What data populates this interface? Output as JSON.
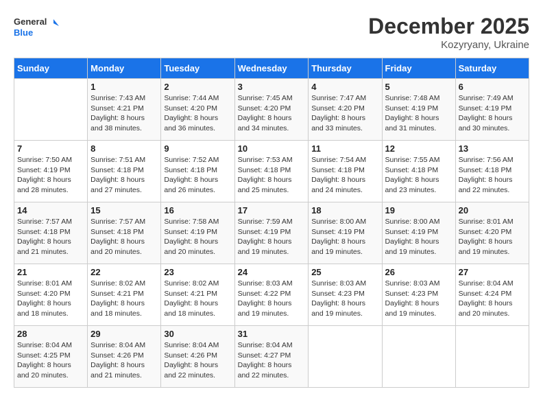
{
  "header": {
    "logo_general": "General",
    "logo_blue": "Blue",
    "month_title": "December 2025",
    "subtitle": "Kozyryany, Ukraine"
  },
  "days_of_week": [
    "Sunday",
    "Monday",
    "Tuesday",
    "Wednesday",
    "Thursday",
    "Friday",
    "Saturday"
  ],
  "weeks": [
    [
      {
        "day": "",
        "sunrise": "",
        "sunset": "",
        "daylight": ""
      },
      {
        "day": "1",
        "sunrise": "Sunrise: 7:43 AM",
        "sunset": "Sunset: 4:21 PM",
        "daylight": "Daylight: 8 hours and 38 minutes."
      },
      {
        "day": "2",
        "sunrise": "Sunrise: 7:44 AM",
        "sunset": "Sunset: 4:20 PM",
        "daylight": "Daylight: 8 hours and 36 minutes."
      },
      {
        "day": "3",
        "sunrise": "Sunrise: 7:45 AM",
        "sunset": "Sunset: 4:20 PM",
        "daylight": "Daylight: 8 hours and 34 minutes."
      },
      {
        "day": "4",
        "sunrise": "Sunrise: 7:47 AM",
        "sunset": "Sunset: 4:20 PM",
        "daylight": "Daylight: 8 hours and 33 minutes."
      },
      {
        "day": "5",
        "sunrise": "Sunrise: 7:48 AM",
        "sunset": "Sunset: 4:19 PM",
        "daylight": "Daylight: 8 hours and 31 minutes."
      },
      {
        "day": "6",
        "sunrise": "Sunrise: 7:49 AM",
        "sunset": "Sunset: 4:19 PM",
        "daylight": "Daylight: 8 hours and 30 minutes."
      }
    ],
    [
      {
        "day": "7",
        "sunrise": "Sunrise: 7:50 AM",
        "sunset": "Sunset: 4:19 PM",
        "daylight": "Daylight: 8 hours and 28 minutes."
      },
      {
        "day": "8",
        "sunrise": "Sunrise: 7:51 AM",
        "sunset": "Sunset: 4:18 PM",
        "daylight": "Daylight: 8 hours and 27 minutes."
      },
      {
        "day": "9",
        "sunrise": "Sunrise: 7:52 AM",
        "sunset": "Sunset: 4:18 PM",
        "daylight": "Daylight: 8 hours and 26 minutes."
      },
      {
        "day": "10",
        "sunrise": "Sunrise: 7:53 AM",
        "sunset": "Sunset: 4:18 PM",
        "daylight": "Daylight: 8 hours and 25 minutes."
      },
      {
        "day": "11",
        "sunrise": "Sunrise: 7:54 AM",
        "sunset": "Sunset: 4:18 PM",
        "daylight": "Daylight: 8 hours and 24 minutes."
      },
      {
        "day": "12",
        "sunrise": "Sunrise: 7:55 AM",
        "sunset": "Sunset: 4:18 PM",
        "daylight": "Daylight: 8 hours and 23 minutes."
      },
      {
        "day": "13",
        "sunrise": "Sunrise: 7:56 AM",
        "sunset": "Sunset: 4:18 PM",
        "daylight": "Daylight: 8 hours and 22 minutes."
      }
    ],
    [
      {
        "day": "14",
        "sunrise": "Sunrise: 7:57 AM",
        "sunset": "Sunset: 4:18 PM",
        "daylight": "Daylight: 8 hours and 21 minutes."
      },
      {
        "day": "15",
        "sunrise": "Sunrise: 7:57 AM",
        "sunset": "Sunset: 4:18 PM",
        "daylight": "Daylight: 8 hours and 20 minutes."
      },
      {
        "day": "16",
        "sunrise": "Sunrise: 7:58 AM",
        "sunset": "Sunset: 4:19 PM",
        "daylight": "Daylight: 8 hours and 20 minutes."
      },
      {
        "day": "17",
        "sunrise": "Sunrise: 7:59 AM",
        "sunset": "Sunset: 4:19 PM",
        "daylight": "Daylight: 8 hours and 19 minutes."
      },
      {
        "day": "18",
        "sunrise": "Sunrise: 8:00 AM",
        "sunset": "Sunset: 4:19 PM",
        "daylight": "Daylight: 8 hours and 19 minutes."
      },
      {
        "day": "19",
        "sunrise": "Sunrise: 8:00 AM",
        "sunset": "Sunset: 4:19 PM",
        "daylight": "Daylight: 8 hours and 19 minutes."
      },
      {
        "day": "20",
        "sunrise": "Sunrise: 8:01 AM",
        "sunset": "Sunset: 4:20 PM",
        "daylight": "Daylight: 8 hours and 19 minutes."
      }
    ],
    [
      {
        "day": "21",
        "sunrise": "Sunrise: 8:01 AM",
        "sunset": "Sunset: 4:20 PM",
        "daylight": "Daylight: 8 hours and 18 minutes."
      },
      {
        "day": "22",
        "sunrise": "Sunrise: 8:02 AM",
        "sunset": "Sunset: 4:21 PM",
        "daylight": "Daylight: 8 hours and 18 minutes."
      },
      {
        "day": "23",
        "sunrise": "Sunrise: 8:02 AM",
        "sunset": "Sunset: 4:21 PM",
        "daylight": "Daylight: 8 hours and 18 minutes."
      },
      {
        "day": "24",
        "sunrise": "Sunrise: 8:03 AM",
        "sunset": "Sunset: 4:22 PM",
        "daylight": "Daylight: 8 hours and 19 minutes."
      },
      {
        "day": "25",
        "sunrise": "Sunrise: 8:03 AM",
        "sunset": "Sunset: 4:23 PM",
        "daylight": "Daylight: 8 hours and 19 minutes."
      },
      {
        "day": "26",
        "sunrise": "Sunrise: 8:03 AM",
        "sunset": "Sunset: 4:23 PM",
        "daylight": "Daylight: 8 hours and 19 minutes."
      },
      {
        "day": "27",
        "sunrise": "Sunrise: 8:04 AM",
        "sunset": "Sunset: 4:24 PM",
        "daylight": "Daylight: 8 hours and 20 minutes."
      }
    ],
    [
      {
        "day": "28",
        "sunrise": "Sunrise: 8:04 AM",
        "sunset": "Sunset: 4:25 PM",
        "daylight": "Daylight: 8 hours and 20 minutes."
      },
      {
        "day": "29",
        "sunrise": "Sunrise: 8:04 AM",
        "sunset": "Sunset: 4:26 PM",
        "daylight": "Daylight: 8 hours and 21 minutes."
      },
      {
        "day": "30",
        "sunrise": "Sunrise: 8:04 AM",
        "sunset": "Sunset: 4:26 PM",
        "daylight": "Daylight: 8 hours and 22 minutes."
      },
      {
        "day": "31",
        "sunrise": "Sunrise: 8:04 AM",
        "sunset": "Sunset: 4:27 PM",
        "daylight": "Daylight: 8 hours and 22 minutes."
      },
      {
        "day": "",
        "sunrise": "",
        "sunset": "",
        "daylight": ""
      },
      {
        "day": "",
        "sunrise": "",
        "sunset": "",
        "daylight": ""
      },
      {
        "day": "",
        "sunrise": "",
        "sunset": "",
        "daylight": ""
      }
    ]
  ]
}
